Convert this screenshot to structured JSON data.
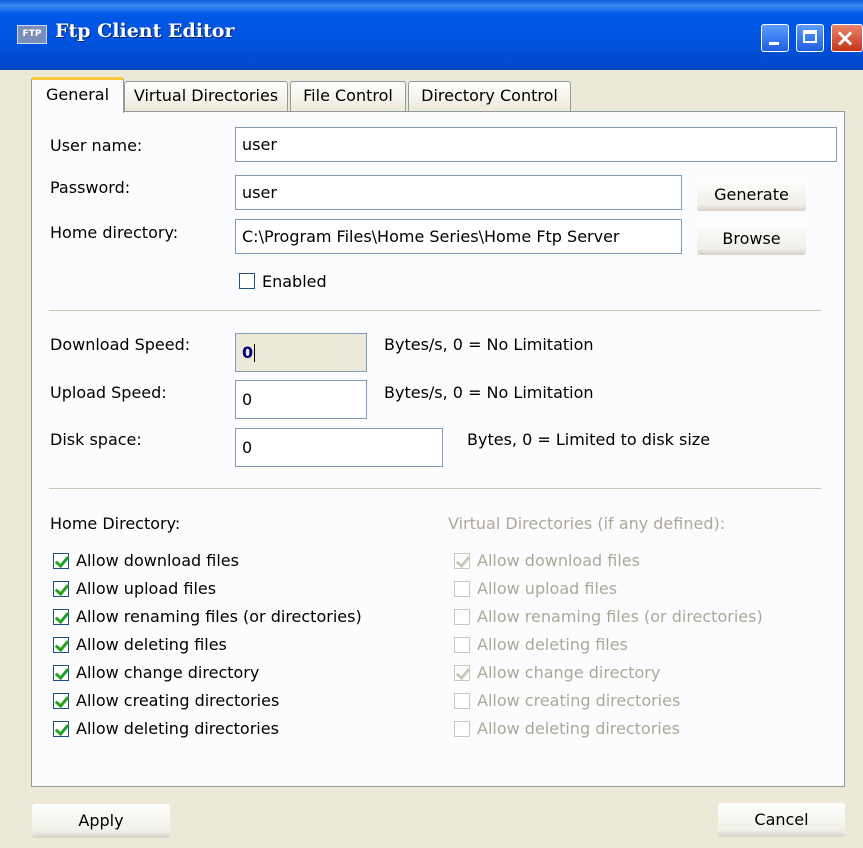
{
  "window": {
    "logo_text": "FTP",
    "title": "Ftp Client Editor"
  },
  "tabs": [
    "General",
    "Virtual Directories",
    "File Control",
    "Directory Control"
  ],
  "general": {
    "user_name_label": "User name:",
    "user_name_value": "user",
    "password_label": "Password:",
    "password_value": "user",
    "generate_button": "Generate",
    "home_dir_label": "Home directory:",
    "home_dir_value": "C:\\Program Files\\Home Series\\Home Ftp Server",
    "browse_button": "Browse",
    "enabled_label": "Enabled",
    "enabled_checked": false
  },
  "limits": {
    "download_label": "Download Speed:",
    "download_value": "0",
    "download_hint": "Bytes/s, 0 = No Limitation",
    "upload_label": "Upload Speed:",
    "upload_value": "0",
    "upload_hint": "Bytes/s, 0 = No Limitation",
    "disk_label": "Disk space:",
    "disk_value": "0",
    "disk_hint": "Bytes, 0 = Limited to disk size"
  },
  "permissions": {
    "home_header": "Home Directory:",
    "virtual_header": "Virtual Directories (if any defined):",
    "home": [
      {
        "label": "Allow download files",
        "checked": true
      },
      {
        "label": "Allow upload files",
        "checked": true
      },
      {
        "label": "Allow renaming files (or directories)",
        "checked": true
      },
      {
        "label": "Allow deleting files",
        "checked": true
      },
      {
        "label": "Allow change directory",
        "checked": true
      },
      {
        "label": "Allow creating directories",
        "checked": true
      },
      {
        "label": "Allow deleting directories",
        "checked": true
      }
    ],
    "virtual": [
      {
        "label": "Allow download files",
        "checked": true
      },
      {
        "label": "Allow upload files",
        "checked": false
      },
      {
        "label": "Allow renaming files (or directories)",
        "checked": false
      },
      {
        "label": "Allow deleting files",
        "checked": false
      },
      {
        "label": "Allow change directory",
        "checked": true
      },
      {
        "label": "Allow creating directories",
        "checked": false
      },
      {
        "label": "Allow deleting directories",
        "checked": false
      }
    ]
  },
  "footer": {
    "apply_button": "Apply",
    "cancel_button": "Cancel"
  }
}
